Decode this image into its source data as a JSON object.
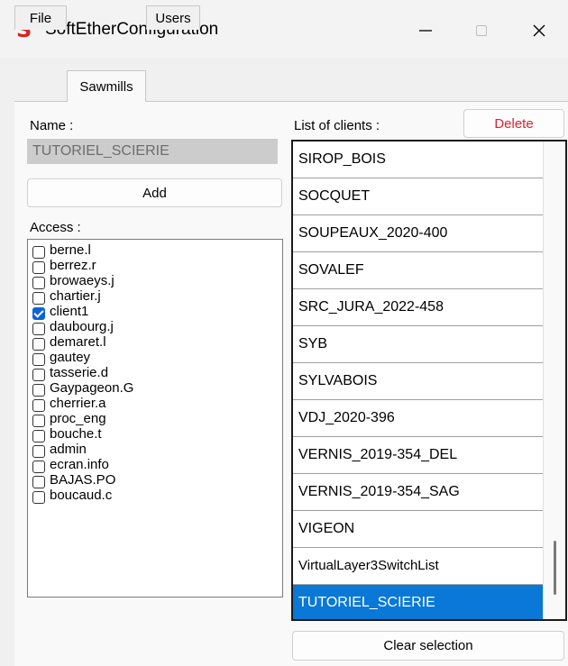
{
  "window": {
    "title": "SoftEtherConfiguration",
    "app_icon": "S",
    "accent": "#e02020"
  },
  "tabs": [
    {
      "label": "File"
    },
    {
      "label": "Sawmills"
    },
    {
      "label": "Users"
    }
  ],
  "name_section": {
    "label": "Name :",
    "value": "TUTORIEL_SCIERIE",
    "add_label": "Add"
  },
  "access": {
    "label": "Access :",
    "items": [
      {
        "label": "berne.l",
        "checked": false
      },
      {
        "label": "berrez.r",
        "checked": false
      },
      {
        "label": "browaeys.j",
        "checked": false
      },
      {
        "label": "chartier.j",
        "checked": false
      },
      {
        "label": "client1",
        "checked": true
      },
      {
        "label": "daubourg.j",
        "checked": false
      },
      {
        "label": "demaret.l",
        "checked": false
      },
      {
        "label": "gautey",
        "checked": false
      },
      {
        "label": "tasserie.d",
        "checked": false
      },
      {
        "label": "Gaypageon.G",
        "checked": false
      },
      {
        "label": "cherrier.a",
        "checked": false
      },
      {
        "label": "proc_eng",
        "checked": false
      },
      {
        "label": "bouche.t",
        "checked": false
      },
      {
        "label": "admin",
        "checked": false
      },
      {
        "label": "ecran.info",
        "checked": false
      },
      {
        "label": "BAJAS.PO",
        "checked": false
      },
      {
        "label": "boucaud.c",
        "checked": false
      }
    ]
  },
  "clients": {
    "label": "List of clients :",
    "delete_label": "Delete",
    "delete_color": "#e0202f",
    "clear_label": "Clear selection",
    "selected_color": "#0a78d7",
    "items": [
      "SIROP_BOIS",
      "SOCQUET",
      "SOUPEAUX_2020-400",
      "SOVALEF",
      "SRC_JURA_2022-458",
      "SYB",
      "SYLVABOIS",
      "VDJ_2020-396",
      "VERNIS_2019-354_DEL",
      "VERNIS_2019-354_SAG",
      "VIGEON",
      "VirtualLayer3SwitchList",
      "TUTORIEL_SCIERIE"
    ],
    "selected": "TUTORIEL_SCIERIE"
  }
}
